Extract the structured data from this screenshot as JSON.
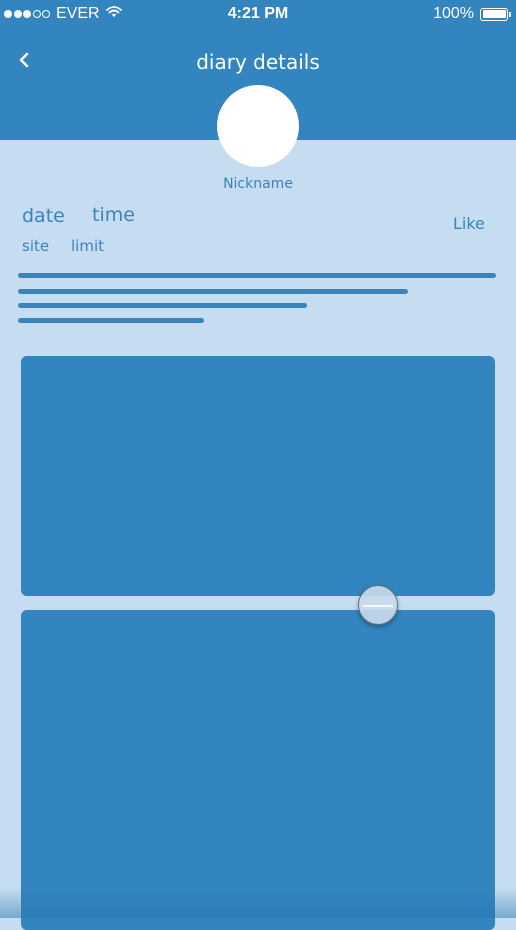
{
  "status_bar": {
    "carrier": "EVER",
    "time": "4:21 PM",
    "battery": "100%",
    "signal_strength": 3,
    "signal_max": 5
  },
  "header": {
    "back_icon": "chevron-left-icon",
    "title": "diary details"
  },
  "profile": {
    "nickname": "Nickname"
  },
  "meta": {
    "date": "date",
    "time": "time",
    "site": "site",
    "limit": "limit",
    "like_label": "Like"
  },
  "colors": {
    "primary": "#3385bf",
    "background": "#c6dcf0",
    "text": "#3b84ba",
    "white": "#ffffff"
  }
}
